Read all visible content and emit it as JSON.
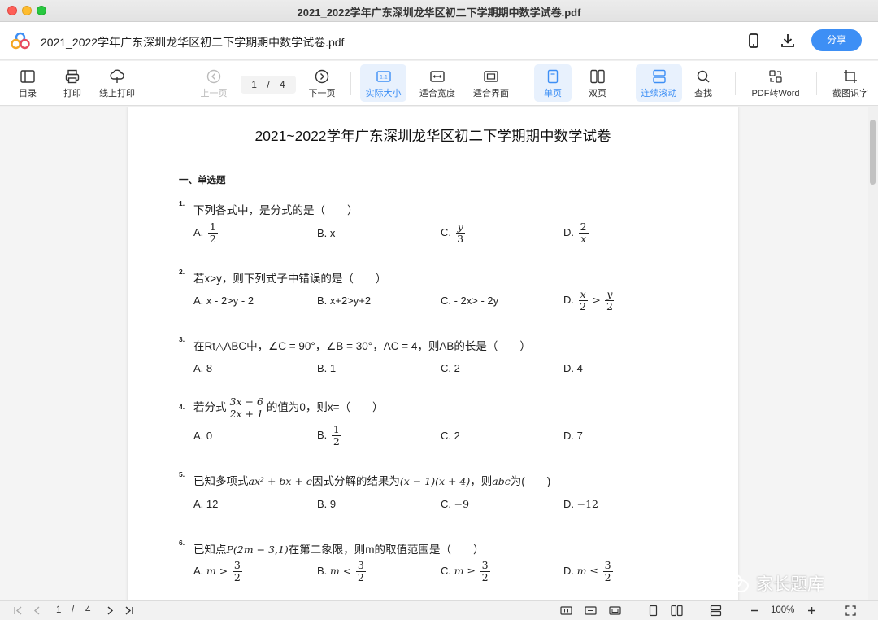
{
  "window": {
    "title": "2021_2022学年广东深圳龙华区初二下学期期中数学试卷.pdf"
  },
  "header": {
    "doc_name": "2021_2022学年广东深圳龙华区初二下学期期中数学试卷.pdf",
    "share": "分享"
  },
  "toolbar": {
    "toc": "目录",
    "print": "打印",
    "online_print": "线上打印",
    "prev": "上一页",
    "page_current": "1",
    "page_sep": "/",
    "page_total": "4",
    "next": "下一页",
    "actual_size": "实际大小",
    "fit_width": "适合宽度",
    "fit_page": "适合界面",
    "single": "单页",
    "double": "双页",
    "continuous": "连续滚动",
    "find": "查找",
    "pdf_to_word": "PDF转Word",
    "ocr": "截图识字",
    "actual_size_glyph": "1:1"
  },
  "paper": {
    "title": "2021~2022学年广东深圳龙华区初二下学期期中数学试卷",
    "section": "一、单选题",
    "q1": {
      "num": "1.",
      "text": "下列各式中，是分式的是（　　）",
      "a": "A.",
      "a_num": "1",
      "a_den": "2",
      "b": "B. x",
      "c": "C.",
      "c_num": "y",
      "c_den": "3",
      "d": "D.",
      "d_num": "2",
      "d_den": "x"
    },
    "q2": {
      "num": "2.",
      "text": "若x>y，则下列式子中错误的是（　　）",
      "a": "A. x - 2>y - 2",
      "b": "B. x+2>y+2",
      "c": "C.  - 2x> - 2y",
      "d": "D.",
      "d_l_num": "x",
      "d_l_den": "2",
      "d_op": ">",
      "d_r_num": "y",
      "d_r_den": "2"
    },
    "q3": {
      "num": "3.",
      "text": "在Rt△ABC中，∠C = 90°，∠B = 30°，AC = 4，则AB的长是（　　）",
      "a": "A. 8",
      "b": "B. 1",
      "c": "C. 2",
      "d": "D. 4"
    },
    "q4": {
      "num": "4.",
      "pre": "若分式",
      "num_expr": "3x − 6",
      "den_expr": "2x + 1",
      "post": "的值为0，则x=（　　）",
      "a": "A. 0",
      "b": "B.",
      "b_num": "1",
      "b_den": "2",
      "c": "C. 2",
      "d": "D. 7"
    },
    "q5": {
      "num": "5.",
      "pre": "已知多项式",
      "expr1": "ax² + bx + c",
      "mid": "因式分解的结果为",
      "expr2": "(x − 1)(x + 4)",
      "mid2": "，则",
      "expr3": "abc",
      "post": "为(　　)",
      "a": "A. 12",
      "b": "B. 9",
      "c_lbl": "C.",
      "c_val": "−9",
      "d_lbl": "D.",
      "d_val": "−12"
    },
    "q6": {
      "num": "6.",
      "pre": "已知点",
      "expr": "P(2m − 3,1)",
      "post": "在第二象限，则m的取值范围是（　　）",
      "a": "A.",
      "a_expr": "m >",
      "b": "B.",
      "b_expr": "m <",
      "c": "C.",
      "c_expr": "m ≥",
      "d": "D.",
      "d_expr": "m ≤",
      "f_num": "3",
      "f_den": "2"
    }
  },
  "statusbar": {
    "page_current": "1",
    "page_sep": "/",
    "page_total": "4",
    "zoom": "100%"
  },
  "watermark": "家长题库",
  "colors": {
    "accent": "#3d8ff5",
    "active_bg": "#e8f1fd"
  }
}
